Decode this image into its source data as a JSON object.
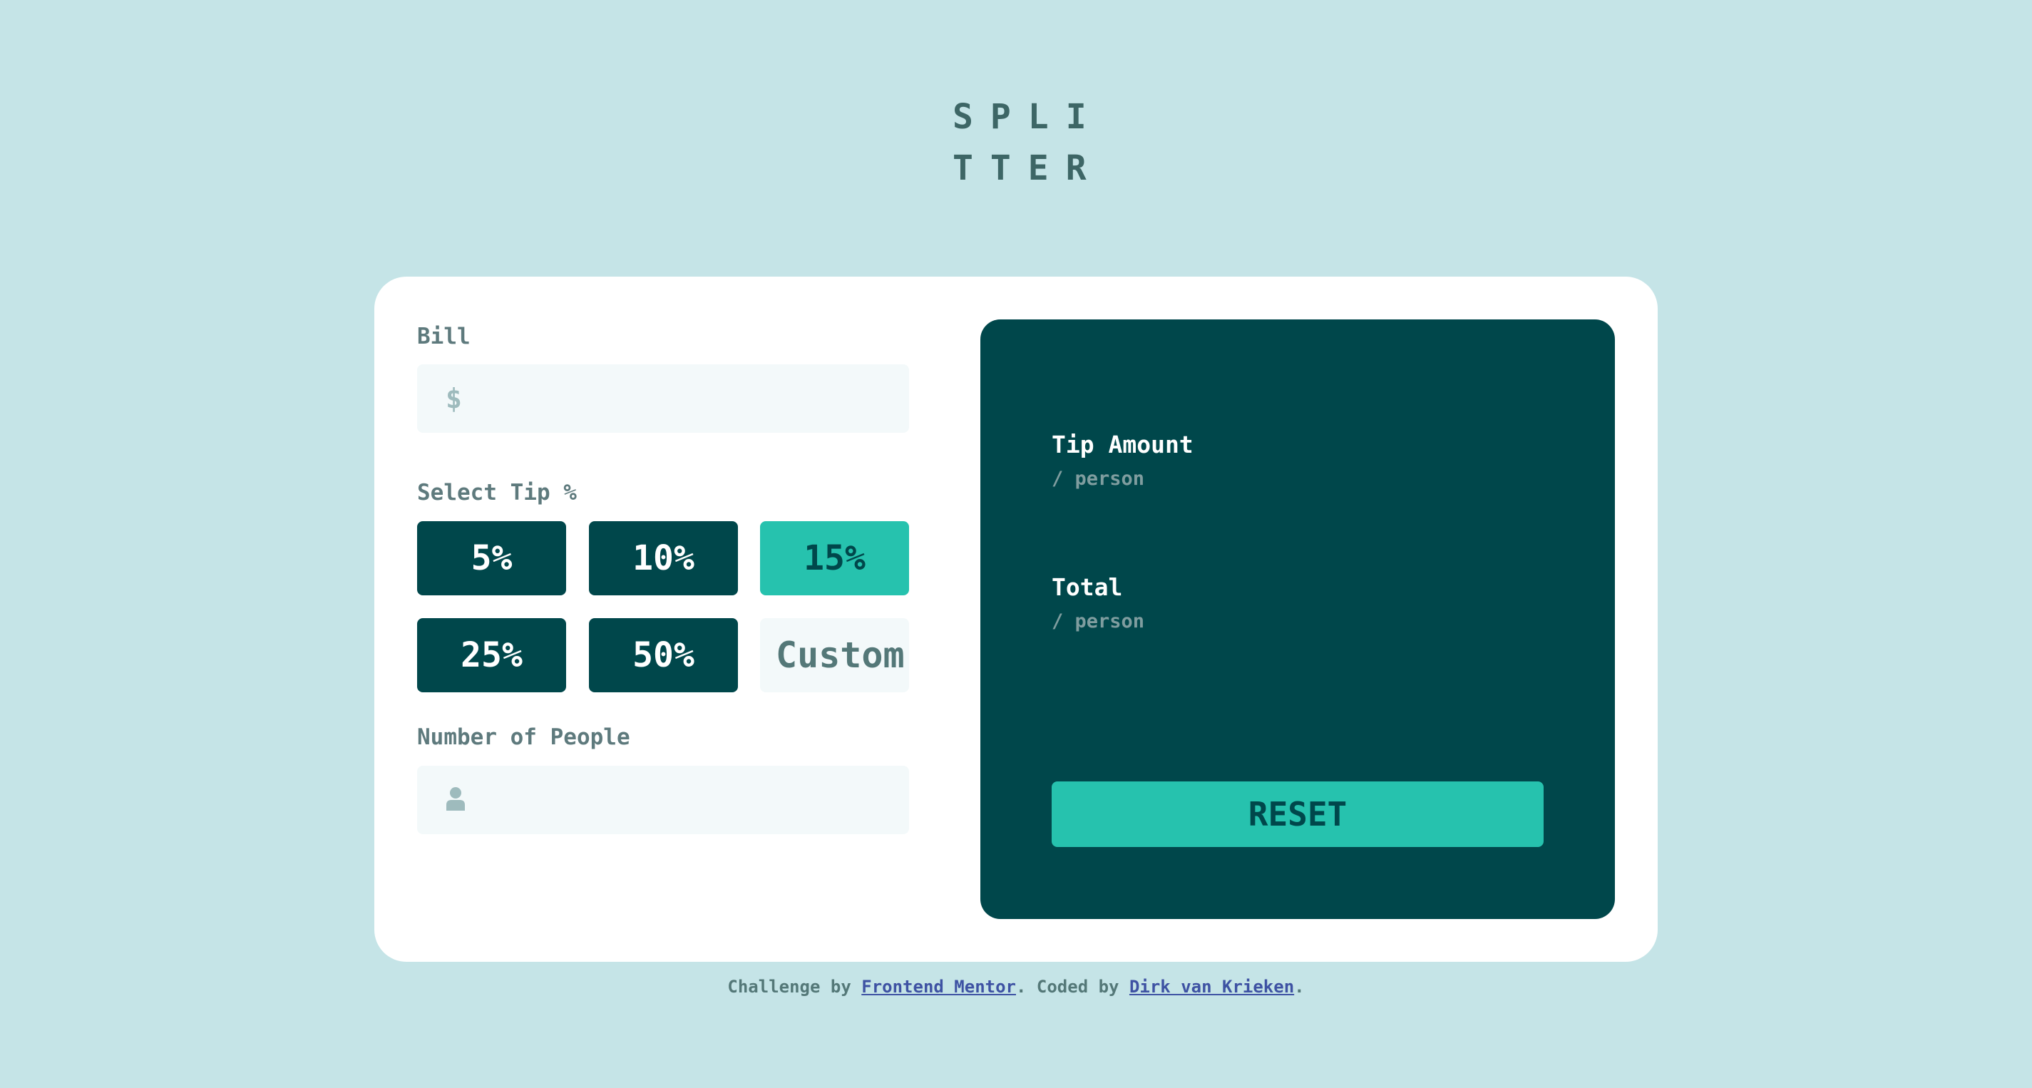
{
  "app": {
    "logo_line1": "SPLI",
    "logo_line2": "TTER"
  },
  "bill": {
    "label": "Bill",
    "currency_icon": "$",
    "value": ""
  },
  "tip": {
    "label": "Select Tip %",
    "options": [
      "5%",
      "10%",
      "15%",
      "25%",
      "50%"
    ],
    "selected": "15%",
    "custom_placeholder": "Custom"
  },
  "people": {
    "label": "Number of People",
    "icon": "person-icon",
    "value": ""
  },
  "results": {
    "tip_amount_label": "Tip Amount",
    "tip_amount_sub": "/ person",
    "tip_amount_value": "",
    "total_label": "Total",
    "total_sub": "/ person",
    "total_value": "",
    "reset_label": "RESET"
  },
  "footer": {
    "prefix": "Challenge by ",
    "link1": "Frontend Mentor",
    "middle": ". Coded by ",
    "link2": "Dirk van Krieken",
    "suffix": "."
  },
  "colors": {
    "background": "#c5e4e7",
    "panel": "#00474b",
    "accent": "#26c2ae",
    "input_bg": "#f3f9fa",
    "label": "#5e7a7d",
    "link": "#3e52a3"
  }
}
